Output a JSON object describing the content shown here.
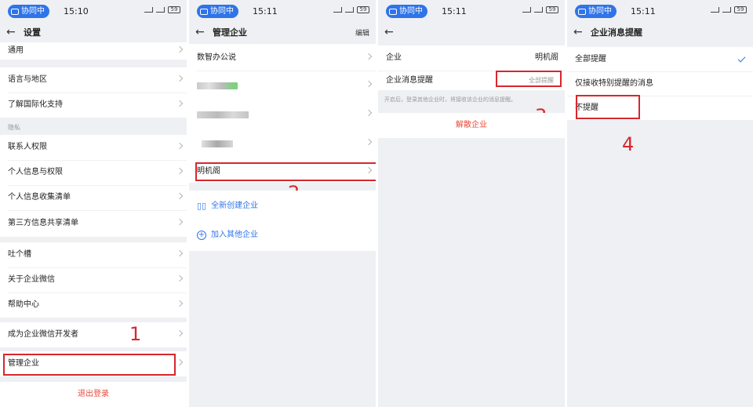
{
  "common": {
    "status_badge": "协同中",
    "battery": "59"
  },
  "panel1": {
    "time": "15:10",
    "title": "设置",
    "items_top": [
      "通用",
      "语言与地区",
      "了解国际化支持"
    ],
    "privacy_label": "隐私",
    "privacy_items": [
      "联系人权限",
      "个人信息与权限",
      "个人信息收集清单",
      "第三方信息共享清单"
    ],
    "help_items": [
      "吐个槽",
      "关于企业微信",
      "帮助中心"
    ],
    "developer": "成为企业微信开发者",
    "manage": "管理企业",
    "logout": "退出登录",
    "step": "1"
  },
  "panel2": {
    "time": "15:11",
    "title": "管理企业",
    "edit": "编辑",
    "company1": "数智办公说",
    "company_selected": "明机阁",
    "create": "全新创建企业",
    "join": "加入其他企业",
    "step": "2"
  },
  "panel3": {
    "time": "15:11",
    "company_label": "企业",
    "company_value": "明机阁",
    "reminder_label": "企业消息提醒",
    "reminder_value": "全部提醒",
    "hint": "开启后，登录其他企业时，将接收该企业的消息提醒。",
    "dissolve": "解散企业",
    "step": "3"
  },
  "panel4": {
    "time": "15:11",
    "title": "企业消息提醒",
    "options": [
      "全部提醒",
      "仅接收特别提醒的消息",
      "不提醒"
    ],
    "selected_index": 0,
    "step": "4"
  }
}
